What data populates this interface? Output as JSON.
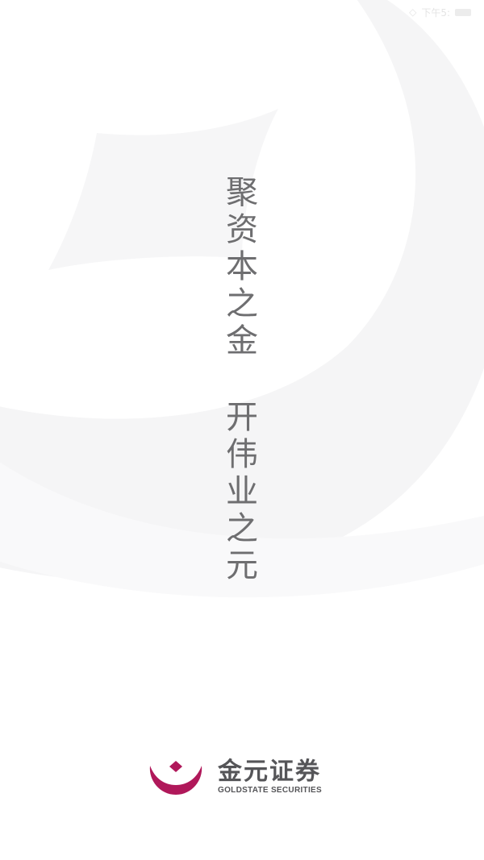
{
  "status_bar": {
    "signal_icon": "wifi-icon",
    "carrier_text": "下午5:",
    "battery_icon": "battery-icon"
  },
  "slogan": {
    "line1": [
      "聚",
      "资",
      "本",
      "之",
      "金"
    ],
    "line2": [
      "开",
      "伟",
      "业",
      "之",
      "元"
    ]
  },
  "brand": {
    "name_cn": "金元证券",
    "name_en": "GOLDSTATE SECURITIES",
    "logo_icon": "goldstate-logo-icon"
  },
  "colors": {
    "background": "#ffffff",
    "watermark": "#f6f6f7",
    "slogan_text": "#6e6e70",
    "brand_text": "#555558",
    "logo_red": "#b0185a"
  }
}
